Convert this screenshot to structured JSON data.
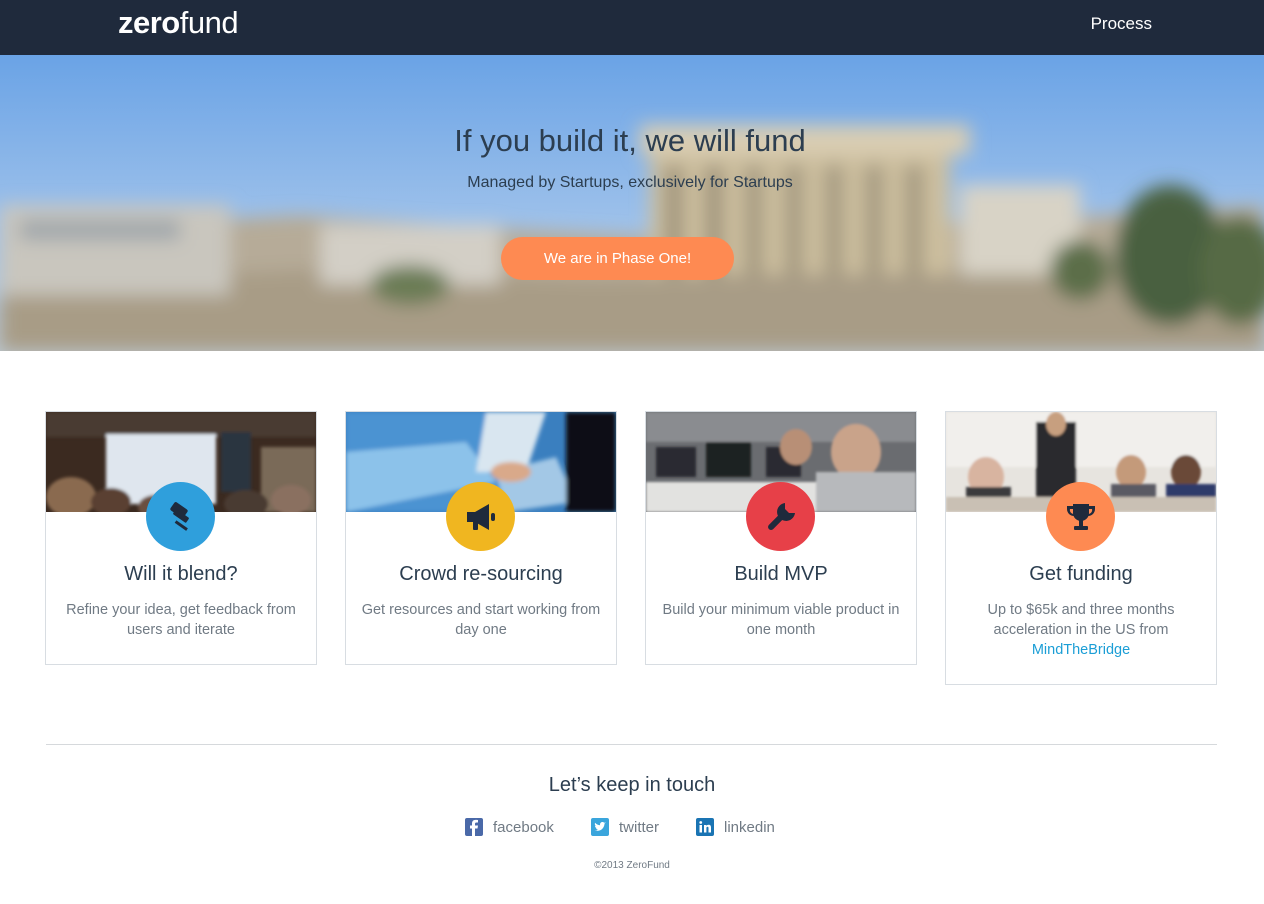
{
  "nav": {
    "logo_bold": "zero",
    "logo_light": "fund",
    "links": [
      "Process"
    ]
  },
  "hero": {
    "title": "If you build it, we will fund",
    "subtitle": "Managed by Startups, exclusively for Startups",
    "cta": "We are in Phase One!"
  },
  "cards": [
    {
      "title": "Will it blend?",
      "text": "Refine your idea, get feedback from users and iterate",
      "icon": "pushpin-icon",
      "color": "#2f9fdc"
    },
    {
      "title": "Crowd re-sourcing",
      "text": "Get resources and start working from day one",
      "icon": "megaphone-icon",
      "color": "#f0b620"
    },
    {
      "title": "Build MVP",
      "text": "Build your minimum viable product in one month",
      "icon": "wrench-icon",
      "color": "#e74048"
    },
    {
      "title": "Get funding",
      "text": "Up to $65k and three months acceleration in the US from",
      "link": "MindTheBridge",
      "icon": "trophy-icon",
      "color": "#fe8a52"
    }
  ],
  "footer": {
    "title": "Let’s keep in touch",
    "social": [
      {
        "label": "facebook",
        "icon": "facebook-icon",
        "color": "#4a69a8"
      },
      {
        "label": "twitter",
        "icon": "twitter-icon",
        "color": "#3aa5dc"
      },
      {
        "label": "linkedin",
        "icon": "linkedin-icon",
        "color": "#1a74b3"
      }
    ],
    "copyright": "©2013 ZeroFund"
  },
  "colors": {
    "navbar": "#1f2a3c",
    "accent": "#fe8a52",
    "text": "#2c3e50",
    "muted": "#707a84",
    "link": "#1b9ed6"
  }
}
